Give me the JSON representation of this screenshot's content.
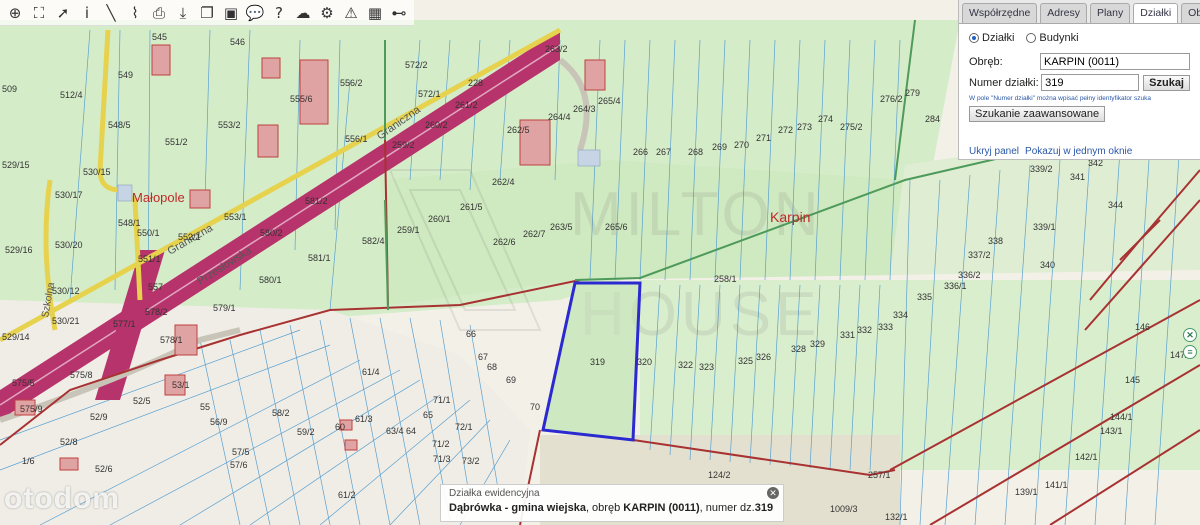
{
  "toolbar": {
    "tools": [
      {
        "icon": "zoom-in-icon",
        "glyph": "⊕"
      },
      {
        "icon": "zoom-extent-icon",
        "glyph": "⛶"
      },
      {
        "icon": "pointer-icon",
        "glyph": "➚"
      },
      {
        "icon": "info-icon",
        "glyph": "i"
      },
      {
        "icon": "measure-line-icon",
        "glyph": "╲"
      },
      {
        "icon": "measure-area-icon",
        "glyph": "⌇"
      },
      {
        "icon": "print-icon",
        "glyph": "⎙"
      },
      {
        "icon": "download-icon",
        "glyph": "⤓"
      },
      {
        "icon": "layers-icon",
        "glyph": "❐"
      },
      {
        "icon": "map-window-icon",
        "glyph": "▣"
      },
      {
        "icon": "comment-icon",
        "glyph": "💬"
      },
      {
        "icon": "help-icon",
        "glyph": "?"
      },
      {
        "icon": "cloud-icon",
        "glyph": "☁"
      },
      {
        "icon": "settings-icon",
        "glyph": "⚙"
      },
      {
        "icon": "warning-icon",
        "glyph": "⚠"
      },
      {
        "icon": "color-grid-icon",
        "glyph": "▦"
      },
      {
        "icon": "share-icon",
        "glyph": "⊷"
      }
    ]
  },
  "panel": {
    "tabs": [
      "Współrzędne",
      "Adresy",
      "Plany",
      "Działki",
      "Obi"
    ],
    "active_tab": 3,
    "radio_dzialki": "Działki",
    "radio_budynki": "Budynki",
    "obreb_label": "Obręb:",
    "obreb_value": "KARPIN (0011)",
    "numer_label": "Numer działki:",
    "numer_value": "319",
    "search_button": "Szukaj",
    "hint": "W pole \"Numer działki\" można wpisać pełny identyfikator szuka",
    "advanced_button": "Szukanie zaawansowane",
    "hide_panel": "Ukryj panel",
    "show_window": "Pokazuj w jednym oknie"
  },
  "info": {
    "title": "Działka ewidencyjna",
    "gmina": "Dąbrówka - gmina wiejska",
    "mid": ", obręb ",
    "obreb": "KARPIN (0011)",
    "mid2": ", numer dz.",
    "numer": "319"
  },
  "watermark": "otodom",
  "map": {
    "place_labels": [
      "Małopole",
      "Karpin",
      "MILTON",
      "HOUSE"
    ],
    "street_labels": [
      "Graniczna",
      "Przesłowska",
      "Szkolna"
    ],
    "parcels": [
      "545",
      "546",
      "549",
      "509",
      "512/4",
      "548/5",
      "551/2",
      "553/2",
      "556/2",
      "555/6",
      "572/2",
      "572/1",
      "263/2",
      "228",
      "261/2",
      "260/2",
      "259/2",
      "556/1",
      "264/3",
      "265/4",
      "264/4",
      "262/5",
      "276/2",
      "279",
      "284",
      "266",
      "267",
      "268",
      "269",
      "270",
      "271",
      "272",
      "273",
      "274",
      "275/2",
      "342",
      "341",
      "339/2",
      "344",
      "338",
      "339/1",
      "337/2",
      "340",
      "336/2",
      "336/1",
      "335",
      "334",
      "333",
      "332",
      "331",
      "329",
      "328",
      "326",
      "325",
      "323",
      "322",
      "320",
      "319",
      "258/1",
      "262/4",
      "261/5",
      "260/1",
      "259/1",
      "582/4",
      "581/2",
      "581/1",
      "580/2",
      "580/1",
      "579/1",
      "553/1",
      "552/1",
      "551/1",
      "550/1",
      "548/1",
      "530/15",
      "530/17",
      "529/15",
      "529/16",
      "530/20",
      "530/12",
      "530/21",
      "529/14",
      "557",
      "578/2",
      "578/1",
      "577/1",
      "575/8",
      "575/5",
      "575/9",
      "53/1",
      "52/5",
      "52/9",
      "55",
      "56/9",
      "57/5",
      "57/6",
      "58/2",
      "59/2",
      "60",
      "61/3",
      "61/4",
      "61/2",
      "63/4",
      "64",
      "65",
      "66",
      "67",
      "68",
      "69",
      "70",
      "71/1",
      "71/2",
      "71/3",
      "72/1",
      "73/2",
      "124/2",
      "257/1",
      "146",
      "145",
      "144/1",
      "143/1",
      "147/2",
      "142/1",
      "141/1",
      "139/1",
      "132/1",
      "1009/3",
      "1/6",
      "52/8",
      "52/6",
      "262/6",
      "262/7",
      "263/5",
      "265/6"
    ]
  }
}
